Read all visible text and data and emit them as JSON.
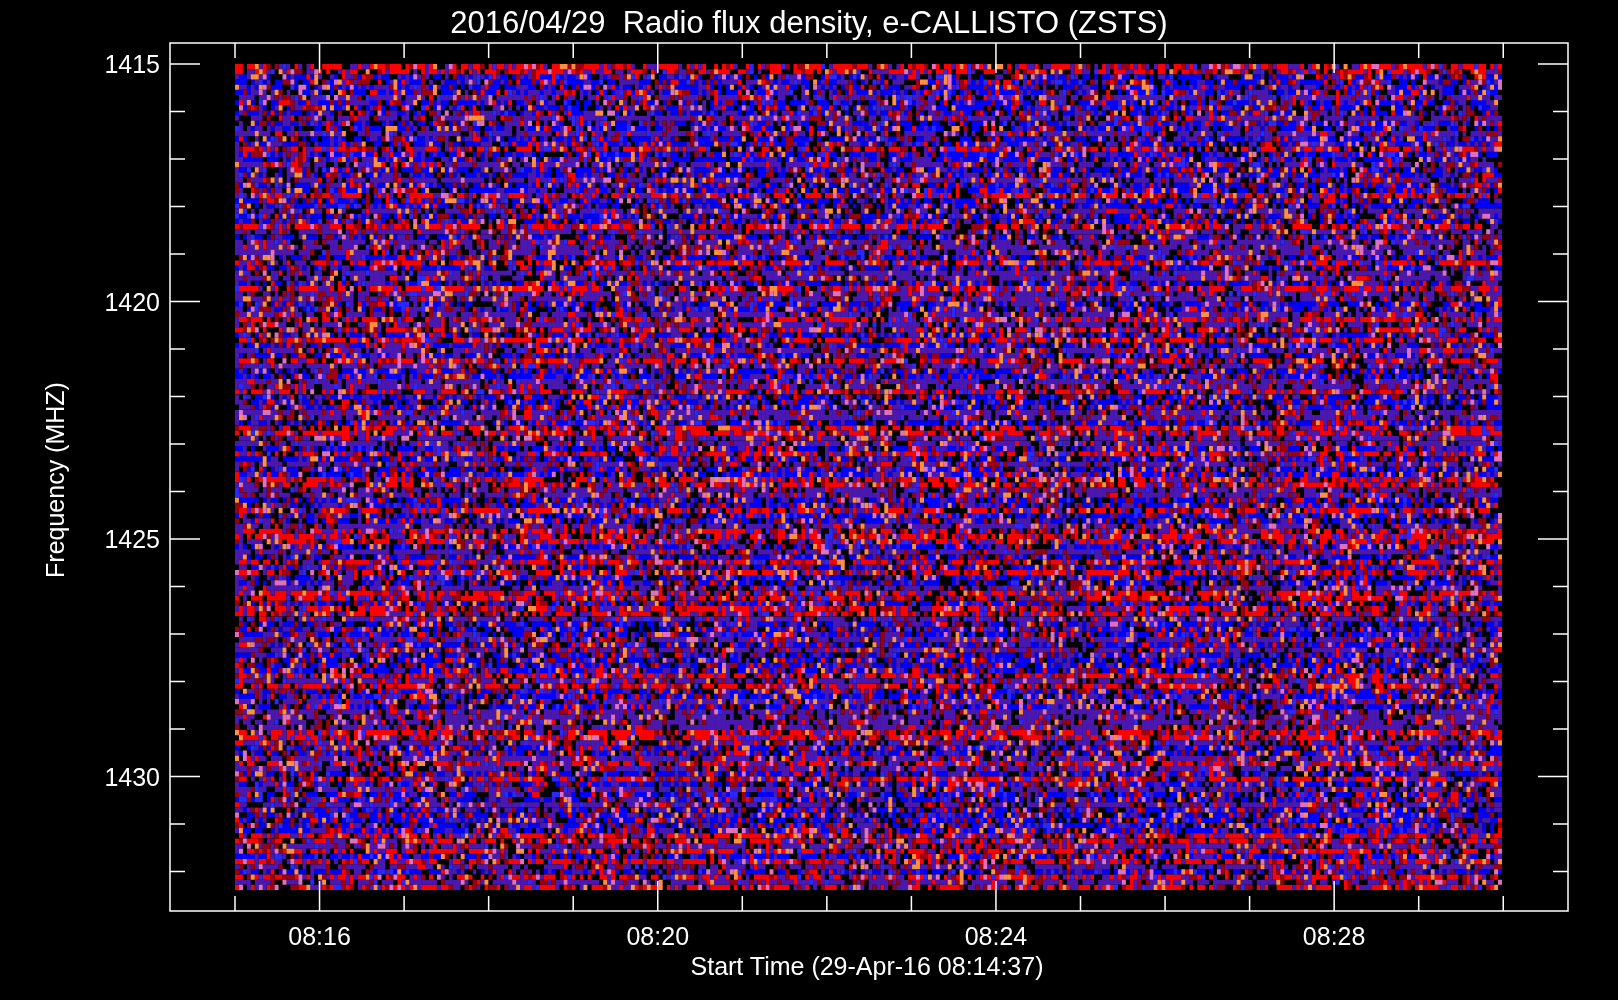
{
  "title": "2016/04/29  Radio flux density, e-CALLISTO (ZSTS)",
  "y_axis": {
    "label": "Frequency (MHZ)",
    "tick_labels": [
      "1415",
      "1420",
      "1425",
      "1430"
    ]
  },
  "x_axis": {
    "label": "Start Time (29-Apr-16 08:14:37)",
    "tick_labels": [
      "08:16",
      "08:20",
      "08:24",
      "08:28"
    ]
  }
}
